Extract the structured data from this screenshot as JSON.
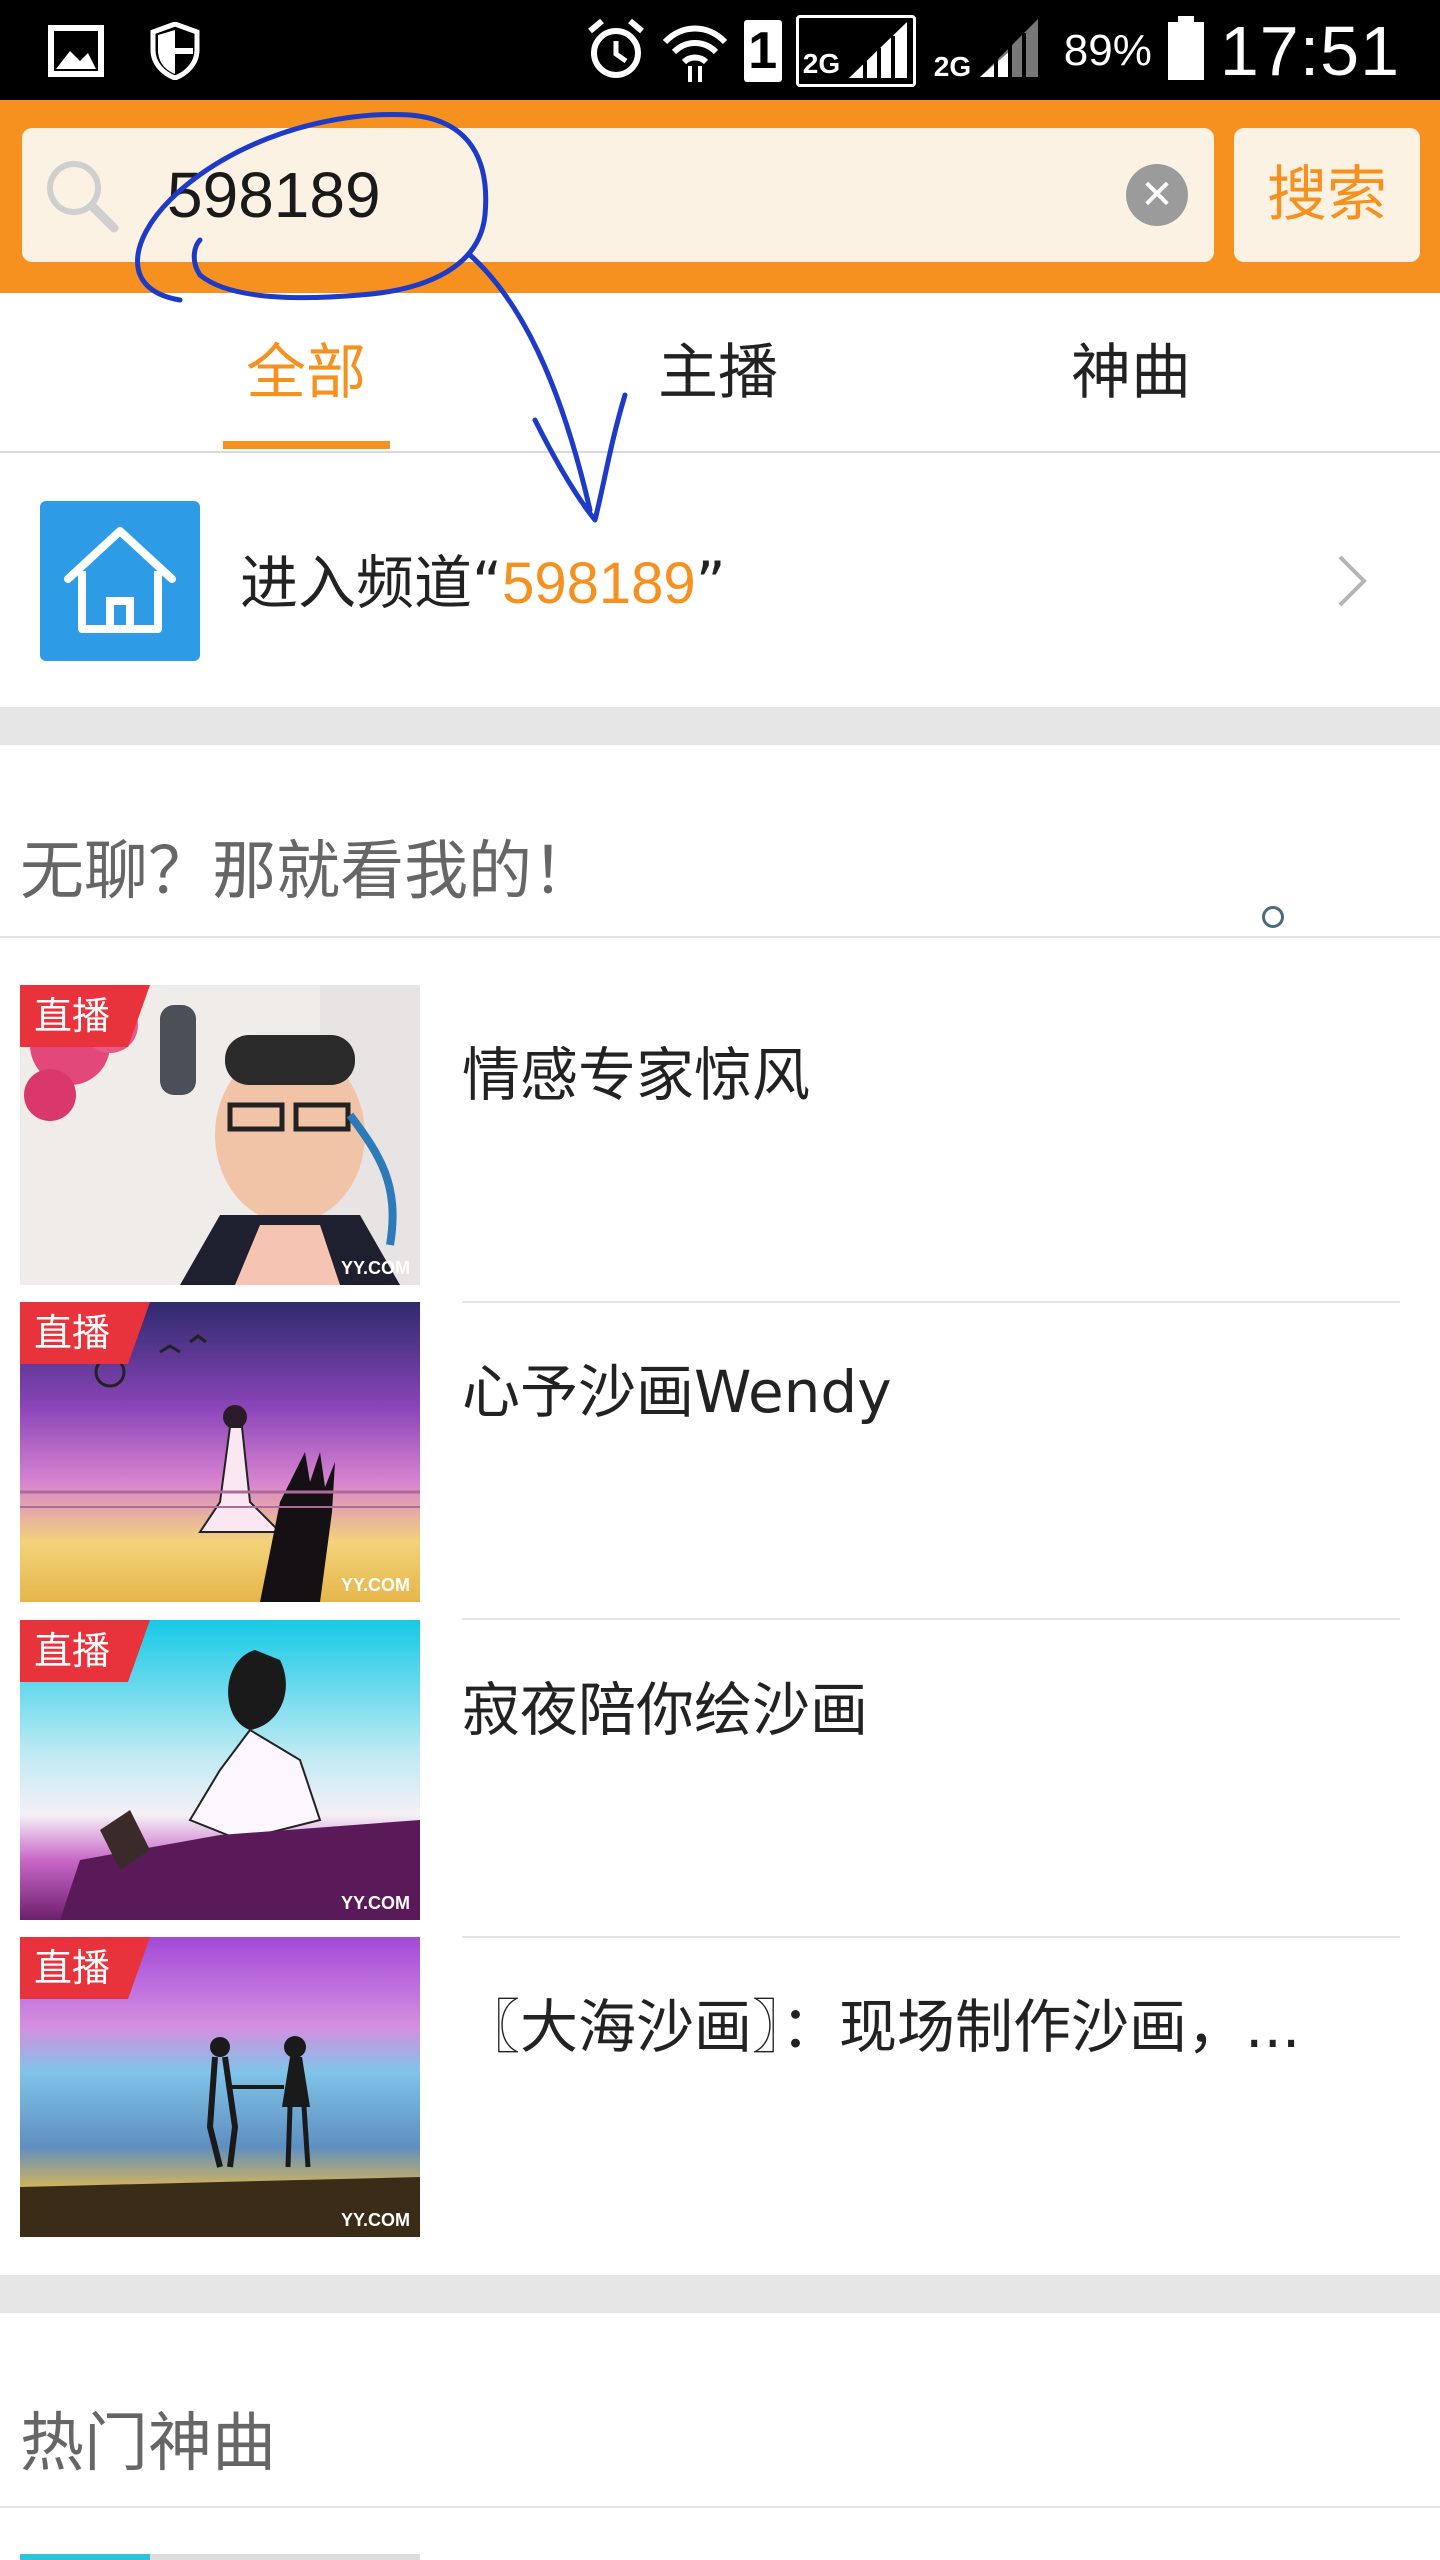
{
  "status_bar": {
    "sim_slot": "1",
    "network_1": "2G",
    "network_2": "2G",
    "battery": "89%",
    "time": "17:51",
    "icons": [
      "gallery-icon",
      "shield-icon",
      "alarm-icon",
      "wifi-icon",
      "sim-icon",
      "signal-icon",
      "signal-icon",
      "battery-icon"
    ]
  },
  "search": {
    "query": "598189",
    "search_button": "搜索"
  },
  "tabs": [
    {
      "label": "全部",
      "active": true
    },
    {
      "label": "主播",
      "active": false
    },
    {
      "label": "神曲",
      "active": false
    }
  ],
  "channel": {
    "prefix": "进入频道“",
    "channel_id": "598189",
    "suffix": "”"
  },
  "recommend": {
    "title": "无聊？那就看我的！",
    "items": [
      {
        "badge": "直播",
        "title": "情感专家惊风",
        "watermark": "YY.COM"
      },
      {
        "badge": "直播",
        "title": "心予沙画Wendy",
        "watermark": "YY.COM"
      },
      {
        "badge": "直播",
        "title": "寂夜陪你绘沙画",
        "watermark": "YY.COM"
      },
      {
        "badge": "直播",
        "title": "〖大海沙画〗：现场制作沙画，...",
        "watermark": "YY.COM"
      }
    ]
  },
  "hot_songs": {
    "title": "热门神曲"
  },
  "colors": {
    "accent": "#f6901e",
    "badge_red": "#e8323c",
    "home_tile": "#2d9be6",
    "annotation_ink": "#1d3bc8"
  }
}
